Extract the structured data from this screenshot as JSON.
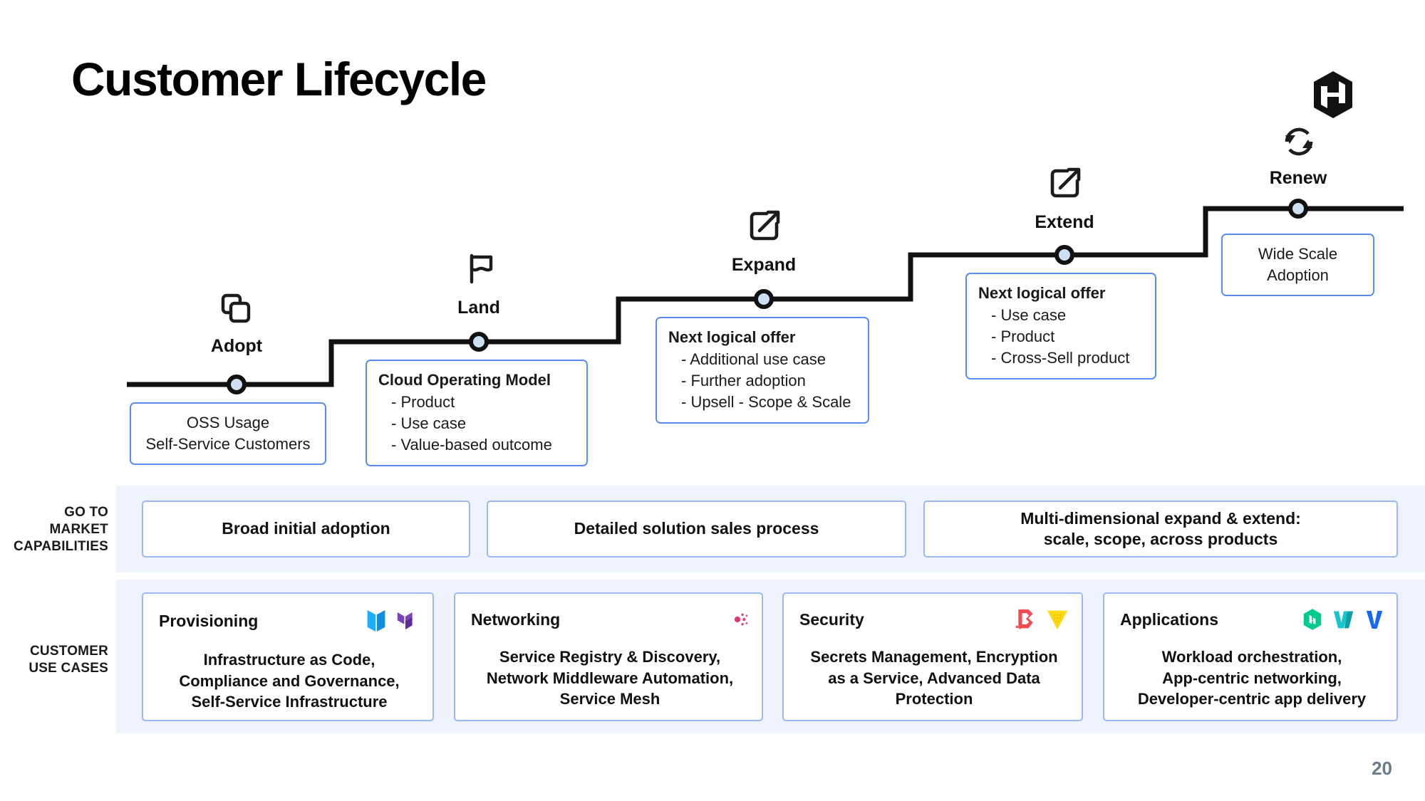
{
  "slide": {
    "title": "Customer Lifecycle",
    "page_number": "20",
    "brand": "hashicorp-logo"
  },
  "colors": {
    "accent_blue": "#5b8def",
    "band_bg": "#eef3fd",
    "card_border": "#9bb8ef",
    "line": "#111111",
    "node_fill": "#cfe0f5",
    "packer": "#1daeff",
    "terraform": "#7b42bc",
    "consul": "#e03875",
    "boundary": "#f24c53",
    "vault": "#ffd814",
    "nomad": "#00ca8e",
    "waypoint": "#14c6cb",
    "vagrant": "#1868f2"
  },
  "stages": [
    {
      "id": "adopt",
      "label": "Adopt",
      "icon": "copy-icon",
      "callout": {
        "style": "centered",
        "heading": "",
        "lines": [
          "OSS Usage",
          "Self-Service Customers"
        ]
      }
    },
    {
      "id": "land",
      "label": "Land",
      "icon": "flag-icon",
      "callout": {
        "style": "list",
        "heading": "Cloud Operating Model",
        "lines": [
          "- Product",
          "- Use case",
          "- Value-based outcome"
        ]
      }
    },
    {
      "id": "expand",
      "label": "Expand",
      "icon": "external-link-icon",
      "callout": {
        "style": "list",
        "heading": "Next logical offer",
        "lines": [
          "- Additional use case",
          "- Further adoption",
          "- Upsell - Scope & Scale"
        ]
      }
    },
    {
      "id": "extend",
      "label": "Extend",
      "icon": "external-link-icon",
      "callout": {
        "style": "list",
        "heading": "Next logical offer",
        "lines": [
          "- Use case",
          "- Product",
          "- Cross-Sell product"
        ]
      }
    },
    {
      "id": "renew",
      "label": "Renew",
      "icon": "refresh-cycle-icon",
      "callout": {
        "style": "centered",
        "heading": "",
        "lines": [
          "Wide Scale",
          "Adoption"
        ]
      }
    }
  ],
  "go_to_market": {
    "label": "GO TO\nMARKET\nCAPABILITIES",
    "label_lines": [
      "GO TO",
      "MARKET",
      "CAPABILITIES"
    ],
    "cards": [
      {
        "lines": [
          "Broad initial adoption"
        ]
      },
      {
        "lines": [
          "Detailed solution sales process"
        ]
      },
      {
        "lines": [
          "Multi-dimensional expand & extend:",
          "scale, scope, across products"
        ]
      }
    ]
  },
  "customer_use_cases": {
    "label_lines": [
      "CUSTOMER",
      "USE CASES"
    ],
    "cards": [
      {
        "title": "Provisioning",
        "icons": [
          "packer-icon",
          "terraform-icon"
        ],
        "body_lines": [
          "Infrastructure as Code,",
          "Compliance and Governance,",
          "Self-Service Infrastructure"
        ]
      },
      {
        "title": "Networking",
        "icons": [
          "consul-icon"
        ],
        "body_lines": [
          "Service Registry & Discovery,",
          "Network Middleware Automation,",
          "Service Mesh"
        ]
      },
      {
        "title": "Security",
        "icons": [
          "boundary-icon",
          "vault-icon"
        ],
        "body_lines": [
          "Secrets Management, Encryption",
          "as a Service, Advanced Data",
          "Protection"
        ]
      },
      {
        "title": "Applications",
        "icons": [
          "nomad-icon",
          "waypoint-icon",
          "vagrant-icon"
        ],
        "body_lines": [
          "Workload orchestration,",
          "App-centric networking,",
          "Developer-centric app delivery"
        ]
      }
    ]
  }
}
